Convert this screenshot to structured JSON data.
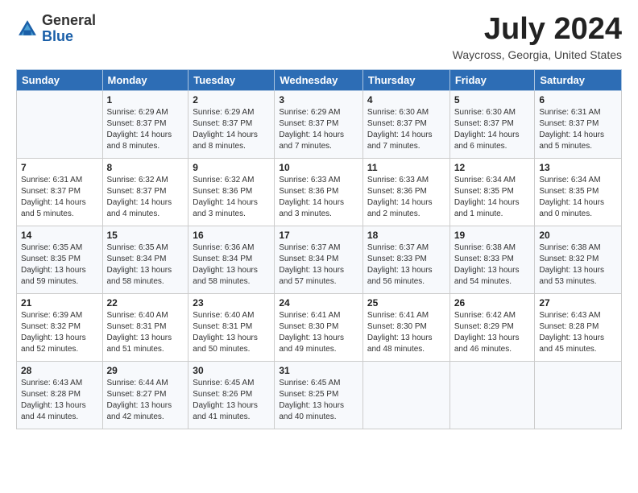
{
  "logo": {
    "general": "General",
    "blue": "Blue"
  },
  "header": {
    "month_title": "July 2024",
    "location": "Waycross, Georgia, United States"
  },
  "days_of_week": [
    "Sunday",
    "Monday",
    "Tuesday",
    "Wednesday",
    "Thursday",
    "Friday",
    "Saturday"
  ],
  "weeks": [
    [
      {
        "day": "",
        "sunrise": "",
        "sunset": "",
        "daylight": ""
      },
      {
        "day": "1",
        "sunrise": "Sunrise: 6:29 AM",
        "sunset": "Sunset: 8:37 PM",
        "daylight": "Daylight: 14 hours and 8 minutes."
      },
      {
        "day": "2",
        "sunrise": "Sunrise: 6:29 AM",
        "sunset": "Sunset: 8:37 PM",
        "daylight": "Daylight: 14 hours and 8 minutes."
      },
      {
        "day": "3",
        "sunrise": "Sunrise: 6:29 AM",
        "sunset": "Sunset: 8:37 PM",
        "daylight": "Daylight: 14 hours and 7 minutes."
      },
      {
        "day": "4",
        "sunrise": "Sunrise: 6:30 AM",
        "sunset": "Sunset: 8:37 PM",
        "daylight": "Daylight: 14 hours and 7 minutes."
      },
      {
        "day": "5",
        "sunrise": "Sunrise: 6:30 AM",
        "sunset": "Sunset: 8:37 PM",
        "daylight": "Daylight: 14 hours and 6 minutes."
      },
      {
        "day": "6",
        "sunrise": "Sunrise: 6:31 AM",
        "sunset": "Sunset: 8:37 PM",
        "daylight": "Daylight: 14 hours and 5 minutes."
      }
    ],
    [
      {
        "day": "7",
        "sunrise": "Sunrise: 6:31 AM",
        "sunset": "Sunset: 8:37 PM",
        "daylight": "Daylight: 14 hours and 5 minutes."
      },
      {
        "day": "8",
        "sunrise": "Sunrise: 6:32 AM",
        "sunset": "Sunset: 8:37 PM",
        "daylight": "Daylight: 14 hours and 4 minutes."
      },
      {
        "day": "9",
        "sunrise": "Sunrise: 6:32 AM",
        "sunset": "Sunset: 8:36 PM",
        "daylight": "Daylight: 14 hours and 3 minutes."
      },
      {
        "day": "10",
        "sunrise": "Sunrise: 6:33 AM",
        "sunset": "Sunset: 8:36 PM",
        "daylight": "Daylight: 14 hours and 3 minutes."
      },
      {
        "day": "11",
        "sunrise": "Sunrise: 6:33 AM",
        "sunset": "Sunset: 8:36 PM",
        "daylight": "Daylight: 14 hours and 2 minutes."
      },
      {
        "day": "12",
        "sunrise": "Sunrise: 6:34 AM",
        "sunset": "Sunset: 8:35 PM",
        "daylight": "Daylight: 14 hours and 1 minute."
      },
      {
        "day": "13",
        "sunrise": "Sunrise: 6:34 AM",
        "sunset": "Sunset: 8:35 PM",
        "daylight": "Daylight: 14 hours and 0 minutes."
      }
    ],
    [
      {
        "day": "14",
        "sunrise": "Sunrise: 6:35 AM",
        "sunset": "Sunset: 8:35 PM",
        "daylight": "Daylight: 13 hours and 59 minutes."
      },
      {
        "day": "15",
        "sunrise": "Sunrise: 6:35 AM",
        "sunset": "Sunset: 8:34 PM",
        "daylight": "Daylight: 13 hours and 58 minutes."
      },
      {
        "day": "16",
        "sunrise": "Sunrise: 6:36 AM",
        "sunset": "Sunset: 8:34 PM",
        "daylight": "Daylight: 13 hours and 58 minutes."
      },
      {
        "day": "17",
        "sunrise": "Sunrise: 6:37 AM",
        "sunset": "Sunset: 8:34 PM",
        "daylight": "Daylight: 13 hours and 57 minutes."
      },
      {
        "day": "18",
        "sunrise": "Sunrise: 6:37 AM",
        "sunset": "Sunset: 8:33 PM",
        "daylight": "Daylight: 13 hours and 56 minutes."
      },
      {
        "day": "19",
        "sunrise": "Sunrise: 6:38 AM",
        "sunset": "Sunset: 8:33 PM",
        "daylight": "Daylight: 13 hours and 54 minutes."
      },
      {
        "day": "20",
        "sunrise": "Sunrise: 6:38 AM",
        "sunset": "Sunset: 8:32 PM",
        "daylight": "Daylight: 13 hours and 53 minutes."
      }
    ],
    [
      {
        "day": "21",
        "sunrise": "Sunrise: 6:39 AM",
        "sunset": "Sunset: 8:32 PM",
        "daylight": "Daylight: 13 hours and 52 minutes."
      },
      {
        "day": "22",
        "sunrise": "Sunrise: 6:40 AM",
        "sunset": "Sunset: 8:31 PM",
        "daylight": "Daylight: 13 hours and 51 minutes."
      },
      {
        "day": "23",
        "sunrise": "Sunrise: 6:40 AM",
        "sunset": "Sunset: 8:31 PM",
        "daylight": "Daylight: 13 hours and 50 minutes."
      },
      {
        "day": "24",
        "sunrise": "Sunrise: 6:41 AM",
        "sunset": "Sunset: 8:30 PM",
        "daylight": "Daylight: 13 hours and 49 minutes."
      },
      {
        "day": "25",
        "sunrise": "Sunrise: 6:41 AM",
        "sunset": "Sunset: 8:30 PM",
        "daylight": "Daylight: 13 hours and 48 minutes."
      },
      {
        "day": "26",
        "sunrise": "Sunrise: 6:42 AM",
        "sunset": "Sunset: 8:29 PM",
        "daylight": "Daylight: 13 hours and 46 minutes."
      },
      {
        "day": "27",
        "sunrise": "Sunrise: 6:43 AM",
        "sunset": "Sunset: 8:28 PM",
        "daylight": "Daylight: 13 hours and 45 minutes."
      }
    ],
    [
      {
        "day": "28",
        "sunrise": "Sunrise: 6:43 AM",
        "sunset": "Sunset: 8:28 PM",
        "daylight": "Daylight: 13 hours and 44 minutes."
      },
      {
        "day": "29",
        "sunrise": "Sunrise: 6:44 AM",
        "sunset": "Sunset: 8:27 PM",
        "daylight": "Daylight: 13 hours and 42 minutes."
      },
      {
        "day": "30",
        "sunrise": "Sunrise: 6:45 AM",
        "sunset": "Sunset: 8:26 PM",
        "daylight": "Daylight: 13 hours and 41 minutes."
      },
      {
        "day": "31",
        "sunrise": "Sunrise: 6:45 AM",
        "sunset": "Sunset: 8:25 PM",
        "daylight": "Daylight: 13 hours and 40 minutes."
      },
      {
        "day": "",
        "sunrise": "",
        "sunset": "",
        "daylight": ""
      },
      {
        "day": "",
        "sunrise": "",
        "sunset": "",
        "daylight": ""
      },
      {
        "day": "",
        "sunrise": "",
        "sunset": "",
        "daylight": ""
      }
    ]
  ]
}
